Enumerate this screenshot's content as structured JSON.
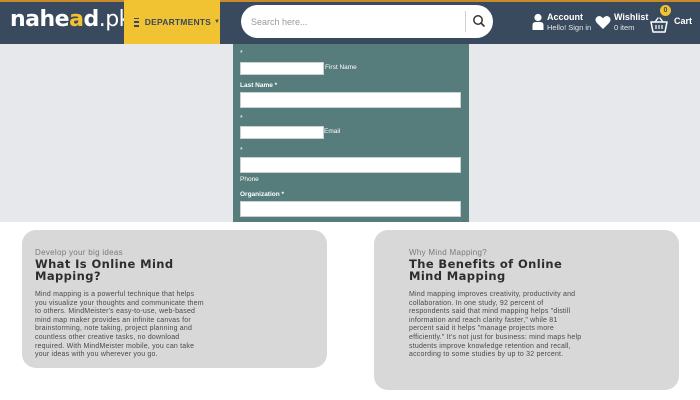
{
  "header": {
    "logo_text_a": "nahe",
    "logo_text_b": "a",
    "logo_text_c": "d",
    "logo_text_d": ".pk",
    "departments_label": "DEPARTMENTS",
    "search_placeholder": "Search here...",
    "account_title": "Account",
    "account_sub": "Hello! Sign in",
    "wishlist_title": "Wishlist",
    "wishlist_sub": "0 item",
    "cart_label": "Cart",
    "cart_count": "0",
    "colors": {
      "header_bg": "#3a4a5e",
      "accent": "#f1c232"
    }
  },
  "form": {
    "first_name_star": "*",
    "first_name_label": "First Name",
    "last_name_label": "Last Name *",
    "email_star": "*",
    "email_label": "Email",
    "phone_star": "*",
    "phone_label": "Phone",
    "organization_label": "Organization *",
    "panel_color": "#567d7c"
  },
  "cards": [
    {
      "eyebrow": "Develop your big ideas",
      "title_line1": "What Is Online Mind",
      "title_line2": "Mapping?",
      "body_lines": [
        "Mind mapping is a powerful technique that helps",
        "you visualize your thoughts and communicate them",
        "to others. MindMeister's easy-to-use, web-based",
        "mind map maker provides an infinite canvas for",
        "brainstorming, note taking, project planning and",
        "countless other creative tasks, no download",
        "required. With MindMeister mobile, you can take",
        "your ideas with you wherever you go."
      ]
    },
    {
      "eyebrow": "Why Mind Mapping?",
      "title_line1": "The Benefits of Online",
      "title_line2": "Mind Mapping",
      "body_lines": [
        "Mind mapping improves creativity, productivity and",
        "collaboration. In one study, 92 percent of",
        "respondents said that mind mapping helps \"distill",
        "information and reach clarity faster,\" while 81",
        "percent said it helps \"manage projects more",
        "efficiently.\" It's not just for business: mind maps help",
        "students improve knowledge retention and recall,",
        "according to some studies by up to 32 percent."
      ]
    }
  ]
}
